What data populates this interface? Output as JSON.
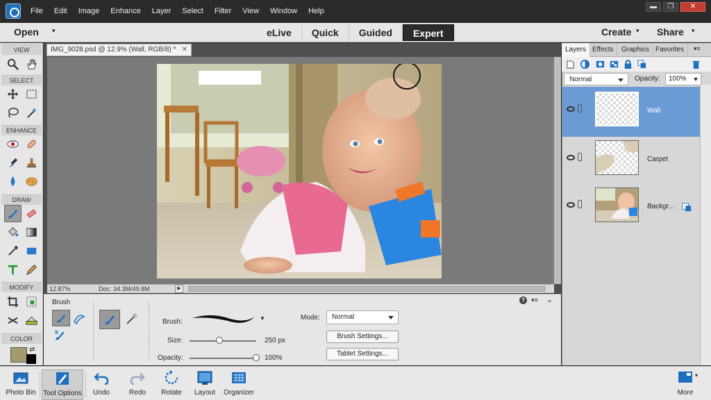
{
  "menu": [
    "File",
    "Edit",
    "Image",
    "Enhance",
    "Layer",
    "Select",
    "Filter",
    "View",
    "Window",
    "Help"
  ],
  "window_controls": {
    "minimize": "▬",
    "maximize": "❐",
    "close": "✕"
  },
  "modebar": {
    "open": "Open",
    "modes": [
      "eLive",
      "Quick",
      "Guided",
      "Expert"
    ],
    "active_mode": "Expert",
    "create": "Create",
    "share": "Share"
  },
  "toolbox": {
    "sections": [
      "VIEW",
      "SELECT",
      "ENHANCE",
      "DRAW",
      "MODIFY",
      "COLOR"
    ]
  },
  "document": {
    "tab_title": "IMG_9028.psd @ 12.9% (Wall, RGB/8) *",
    "zoom": "12.87%",
    "doc_info": "Doc: 34.3M/49.8M"
  },
  "options": {
    "tool_title": "Brush",
    "brush_label": "Brush:",
    "size_label": "Size:",
    "size_value": "250 px",
    "size_fraction": 0.45,
    "opacity_label": "Opacity:",
    "opacity_value": "100%",
    "opacity_fraction": 1.0,
    "mode_label": "Mode:",
    "mode_value": "Normal",
    "brush_settings": "Brush Settings...",
    "tablet_settings": "Tablet Settings..."
  },
  "panel": {
    "tabs": [
      "Layers",
      "Effects",
      "Graphics",
      "Favorites"
    ],
    "active_tab": "Layers",
    "blend_mode": "Normal",
    "opacity_label": "Opacity:",
    "opacity_value": "100%",
    "layers": [
      {
        "name": "Wall",
        "selected": true
      },
      {
        "name": "Carpet",
        "selected": false
      },
      {
        "name": "Backgr...",
        "selected": false
      }
    ]
  },
  "bottom_bar": {
    "buttons": [
      "Photo Bin",
      "Tool Options",
      "Undo",
      "Redo",
      "Rotate",
      "Layout",
      "Organizer"
    ],
    "more": "More"
  },
  "colors": {
    "accent": "#6b9bd4",
    "foreground_swatch": "#a49a6e",
    "background_swatch": "#000000"
  }
}
